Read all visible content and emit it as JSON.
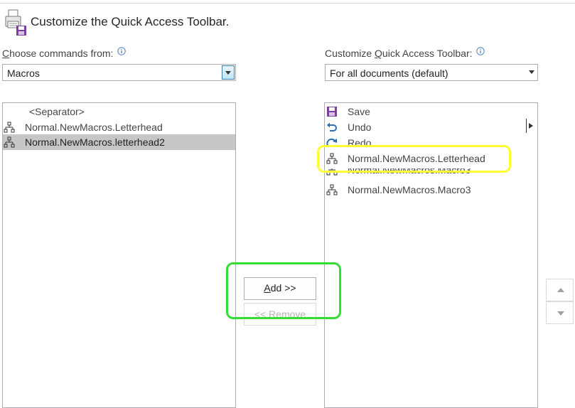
{
  "dialog": {
    "title": "Customize the Quick Access Toolbar."
  },
  "left": {
    "label_prefix": "",
    "label_access": "C",
    "label_rest": "hoose commands from:",
    "combo_value": "Macros",
    "items": [
      {
        "label": "<Separator>"
      },
      {
        "label": "Normal.NewMacros.Letterhead"
      },
      {
        "label": "Normal.NewMacros.letterhead2"
      }
    ]
  },
  "right": {
    "label_prefix": "Customize ",
    "label_access": "Q",
    "label_rest": "uick Access Toolbar:",
    "combo_value": "For all documents (default)",
    "items": [
      {
        "label": "Save",
        "icon": "save-icon"
      },
      {
        "label": "Undo",
        "icon": "undo-icon"
      },
      {
        "label": "Redo",
        "icon": "redo-icon"
      },
      {
        "label": "Normal.NewMacros.Letterhead",
        "icon": "macro-icon"
      },
      {
        "label": "Normal.NewMacros.Macro3",
        "icon": "macro-icon"
      },
      {
        "label": "Normal.NewMacros.Macro3",
        "icon": "macro-icon"
      }
    ]
  },
  "buttons": {
    "add_access": "A",
    "add_rest": "dd >>",
    "remove": "<< Remove"
  },
  "colors": {
    "highlight_yellow": "#ffff33",
    "highlight_green": "#33dd33",
    "selection": "#c6c6c6"
  }
}
